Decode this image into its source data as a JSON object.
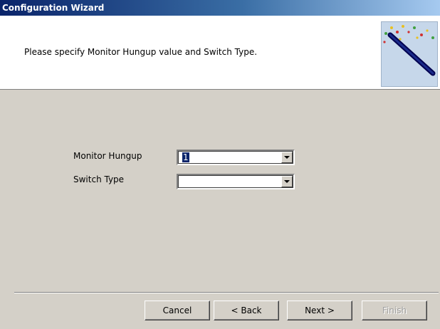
{
  "window": {
    "title": "Configuration Wizard"
  },
  "header": {
    "instruction": "Please specify Monitor Hungup value and Switch Type.",
    "image_icon": "magic-wand-icon"
  },
  "form": {
    "monitor_hungup": {
      "label": "Monitor Hungup",
      "value": "1"
    },
    "switch_type": {
      "label": "Switch Type",
      "value": ""
    }
  },
  "buttons": {
    "cancel": "Cancel",
    "back": "< Back",
    "next": "Next >",
    "finish": "Finish"
  },
  "colors": {
    "titlebar_start": "#0a246a",
    "titlebar_end": "#a6caf0",
    "dialog_face": "#d4d0c8",
    "selection": "#0a246a"
  }
}
